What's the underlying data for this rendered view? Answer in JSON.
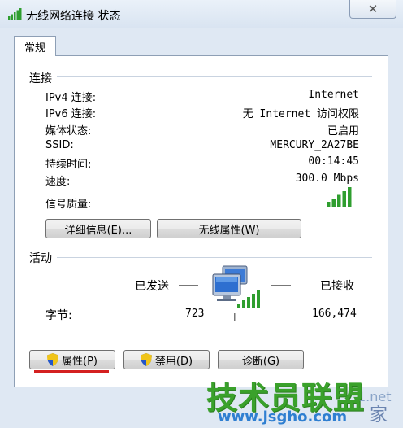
{
  "window": {
    "title": "无线网络连接 状态",
    "close_label": "✕"
  },
  "tab": {
    "label": "常规"
  },
  "connection": {
    "heading": "连接",
    "rows": [
      {
        "label": "IPv4 连接:",
        "value": "Internet"
      },
      {
        "label": "IPv6 连接:",
        "value": "无 Internet 访问权限"
      },
      {
        "label": "媒体状态:",
        "value": "已启用"
      },
      {
        "label": "SSID:",
        "value": "MERCURY_2A27BE"
      },
      {
        "label": "持续时间:",
        "value": "00:14:45"
      },
      {
        "label": "速度:",
        "value": "300.0 Mbps"
      }
    ],
    "signal_label": "信号质量:",
    "signal_bars": 5,
    "details_button": "详细信息(E)...",
    "wireless_props_button": "无线属性(W)"
  },
  "activity": {
    "heading": "活动",
    "sent_label": "已发送",
    "received_label": "已接收",
    "bytes_label": "字节:",
    "sent_bytes": "723",
    "received_bytes": "166,474"
  },
  "buttons": {
    "properties": "属性(P)",
    "disable": "禁用(D)",
    "diagnose": "诊断(G)"
  },
  "watermark": {
    "brand": "技术员联盟",
    "url": "www.jsgho.com",
    "partial": "1.net",
    "partial_char": "家"
  },
  "colors": {
    "signal_green": "#2f9e2f",
    "highlight_red": "#d42020",
    "watermark_green": "#3aa12b"
  },
  "icons": {
    "title": "wireless-signal-icon",
    "shield": "uac-shield-icon",
    "network": "network-computers-icon"
  }
}
